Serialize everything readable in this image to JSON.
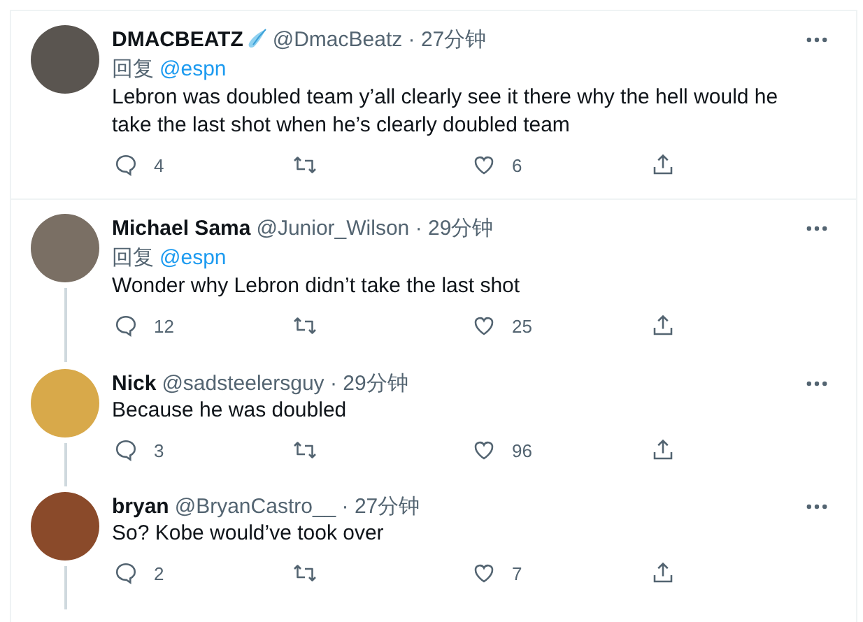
{
  "tweets": [
    {
      "name": "DMACBEATZ",
      "name_icon": true,
      "meta": "@DmacBeatz · 27分钟",
      "reply_label": "回复",
      "reply_to": "@espn",
      "text": "Lebron was doubled team y’all clearly see it there why the hell would he take the last shot when he’s clearly doubled team",
      "replies": "4",
      "likes": "6",
      "thread_continues": false
    },
    {
      "name": "Michael Sama",
      "name_icon": false,
      "meta": "@Junior_Wilson · 29分钟",
      "reply_label": "回复",
      "reply_to": "@espn",
      "text": "Wonder why Lebron didn’t take the last shot",
      "replies": "12",
      "likes": "25",
      "thread_continues": true
    },
    {
      "name": "Nick",
      "name_icon": false,
      "meta": "@sadsteelersguy · 29分钟",
      "text": "Because he was doubled",
      "replies": "3",
      "likes": "96",
      "thread_continues": true
    },
    {
      "name": "bryan",
      "name_icon": false,
      "meta": "@BryanCastro__ · 27分钟",
      "text": "So? Kobe would’ve took over",
      "replies": "2",
      "likes": "7",
      "thread_continues": true
    }
  ]
}
